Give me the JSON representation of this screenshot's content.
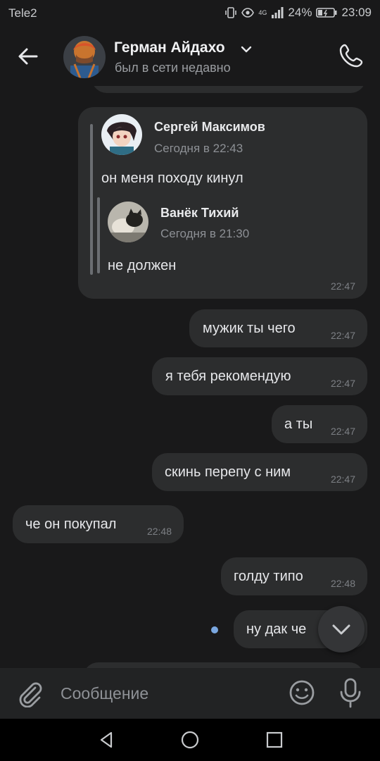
{
  "status_bar": {
    "carrier": "Tele2",
    "network": "4G",
    "battery": "24%",
    "time": "23:09"
  },
  "header": {
    "name": "Герман Айдахо",
    "status": "был в сети недавно"
  },
  "forwarded_message": {
    "outer_author": "Сергей Максимов",
    "outer_date": "Сегодня в 22:43",
    "outer_text": "он меня походу кинул",
    "inner_author": "Ванёк Тихий",
    "inner_date": "Сегодня в 21:30",
    "inner_text": "не должен",
    "time": "22:47"
  },
  "messages": [
    {
      "text": "мужик ты чего",
      "time": "22:47",
      "side": "out"
    },
    {
      "text": "я тебя рекомендую",
      "time": "22:47",
      "side": "out"
    },
    {
      "text": "а ты",
      "time": "22:47",
      "side": "out"
    },
    {
      "text": "скинь перепу с ним",
      "time": "22:47",
      "side": "out"
    },
    {
      "text": "че он покупал",
      "time": "22:48",
      "side": "in"
    },
    {
      "text": "голду типо",
      "time": "22:48",
      "side": "out"
    },
    {
      "text": "ну дак че",
      "time": "",
      "side": "out"
    }
  ],
  "composer": {
    "placeholder": "Сообщение"
  },
  "colors": {
    "background": "#19191a",
    "bubble": "#2c2d2e",
    "unread_dot": "#7aa7e0"
  },
  "icons": [
    "arrow-left-icon",
    "chevron-down-icon",
    "phone-icon",
    "attach-icon",
    "sticker-icon",
    "microphone-icon",
    "chevron-down-icon",
    "nav-back-icon",
    "nav-home-icon",
    "nav-recent-icon"
  ]
}
